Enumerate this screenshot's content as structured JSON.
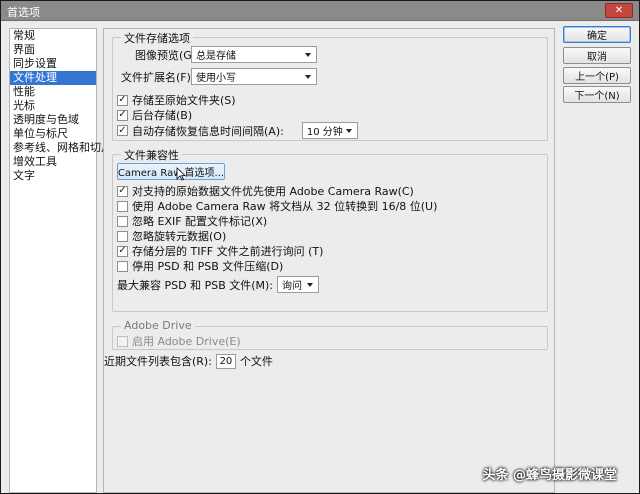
{
  "window": {
    "title": "首选项",
    "close_icon": "close-icon"
  },
  "sidebar": {
    "items": [
      {
        "label": "常规",
        "selected": false
      },
      {
        "label": "界面",
        "selected": false
      },
      {
        "label": "同步设置",
        "selected": false
      },
      {
        "label": "文件处理",
        "selected": true
      },
      {
        "label": "性能",
        "selected": false
      },
      {
        "label": "光标",
        "selected": false
      },
      {
        "label": "透明度与色域",
        "selected": false
      },
      {
        "label": "单位与标尺",
        "selected": false
      },
      {
        "label": "参考线、网格和切片",
        "selected": false
      },
      {
        "label": "增效工具",
        "selected": false
      },
      {
        "label": "文字",
        "selected": false
      }
    ]
  },
  "file_saving": {
    "title": "文件存储选项",
    "image_preview_label": "图像预览(G):",
    "image_preview_value": "总是存储",
    "extension_label": "文件扩展名(F):",
    "extension_value": "使用小写",
    "save_to_original_folder": {
      "label": "存储至原始文件夹(S)",
      "checked": true
    },
    "background_save": {
      "label": "后台存储(B)",
      "checked": true
    },
    "auto_save": {
      "label": "自动存储恢复信息时间间隔(A):",
      "checked": true
    },
    "auto_save_interval": "10 分钟"
  },
  "compatibility": {
    "title": "文件兼容性",
    "camera_raw_button": "Camera Raw 首选项...",
    "options": [
      {
        "label": "对支持的原始数据文件优先使用 Adobe Camera Raw(C)",
        "checked": true
      },
      {
        "label": "使用 Adobe Camera Raw 将文档从 32 位转换到 16/8 位(U)",
        "checked": false
      },
      {
        "label": "忽略 EXIF 配置文件标记(X)",
        "checked": false
      },
      {
        "label": "忽略旋转元数据(O)",
        "checked": false
      },
      {
        "label": "存储分层的 TIFF 文件之前进行询问 (T)",
        "checked": true
      },
      {
        "label": "停用 PSD 和 PSB 文件压缩(D)",
        "checked": false
      }
    ],
    "max_compat_label": "最大兼容 PSD 和 PSB 文件(M):",
    "max_compat_value": "询问"
  },
  "adobe_drive": {
    "title": "Adobe Drive",
    "enable_label": "启用 Adobe Drive(E)",
    "checked": false,
    "disabled": true
  },
  "recent_files": {
    "label_before": "近期文件列表包含(R):",
    "value": "20",
    "label_after": "个文件"
  },
  "buttons": {
    "ok": "确定",
    "cancel": "取消",
    "prev": "上一个(P)",
    "next": "下一个(N)"
  },
  "watermark": "头条 @蜂鸟摄影微课堂"
}
